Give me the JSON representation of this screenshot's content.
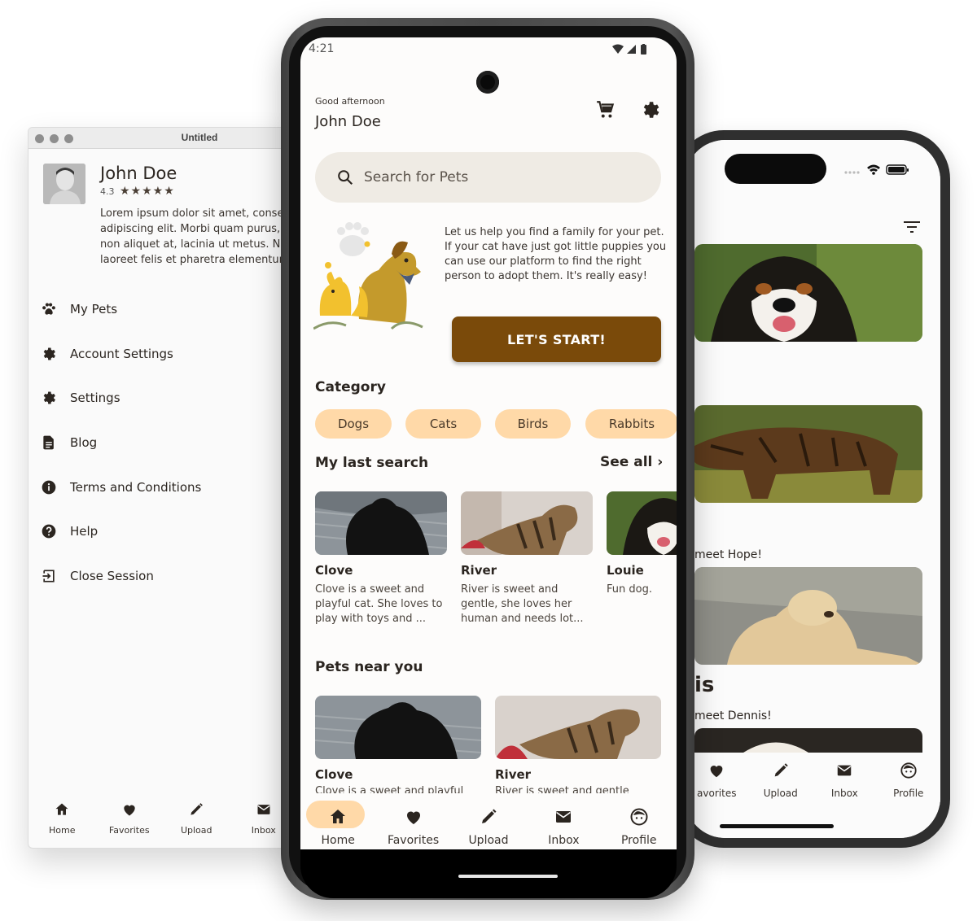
{
  "desktop": {
    "window_title": "Untitled",
    "profile": {
      "name": "John Doe",
      "rating": "4.3",
      "stars": "★★★★★",
      "bio_lines": [
        "Lorem ipsum dolor sit amet, conse",
        "adipiscing elit. Morbi quam purus,",
        "non aliquet at, lacinia ut metus. Nc",
        "laoreet felis et pharetra elementur"
      ]
    },
    "menu": [
      {
        "label": "My Pets",
        "icon": "paw-icon"
      },
      {
        "label": "Account Settings",
        "icon": "gear-icon"
      },
      {
        "label": "Settings",
        "icon": "gear-icon"
      },
      {
        "label": "Blog",
        "icon": "document-icon"
      },
      {
        "label": "Terms and Conditions",
        "icon": "info-icon"
      },
      {
        "label": "Help",
        "icon": "help-icon"
      },
      {
        "label": "Close Session",
        "icon": "logout-icon"
      }
    ],
    "nav": [
      {
        "label": "Home",
        "icon": "home-icon"
      },
      {
        "label": "Favorites",
        "icon": "heart-icon"
      },
      {
        "label": "Upload",
        "icon": "pencil-icon"
      },
      {
        "label": "Inbox",
        "icon": "mail-icon"
      }
    ]
  },
  "android": {
    "status": {
      "time": "4:21"
    },
    "greeting": "Good afternoon",
    "user_name": "John Doe",
    "search": {
      "placeholder": "Search for Pets"
    },
    "hero": {
      "text": "Let us help you find a family for your pet. If your cat have just got little puppies you can use our platform to find the right person to adopt them. It's really easy!",
      "button": "LET'S START!"
    },
    "category": {
      "title": "Category",
      "chips": [
        "Dogs",
        "Cats",
        "Birds",
        "Rabbits"
      ]
    },
    "last_search": {
      "title": "My last search",
      "see_all": "See all ›",
      "cards": [
        {
          "name": "Clove",
          "desc": "Clove is a sweet and playful cat. She loves to play with toys and ..."
        },
        {
          "name": "River",
          "desc": "River is sweet and gentle, she loves her human and needs lot..."
        },
        {
          "name": "Louie",
          "desc": "Fun dog."
        }
      ]
    },
    "near": {
      "title": "Pets near you",
      "cards": [
        {
          "name": "Clove",
          "desc": "Clove is a sweet and playful"
        },
        {
          "name": "River",
          "desc": "River is sweet and gentle"
        }
      ]
    },
    "nav": [
      {
        "label": "Home",
        "icon": "home-icon",
        "active": true
      },
      {
        "label": "Favorites",
        "icon": "heart-icon"
      },
      {
        "label": "Upload",
        "icon": "pencil-icon"
      },
      {
        "label": "Inbox",
        "icon": "mail-icon"
      },
      {
        "label": "Profile",
        "icon": "face-icon"
      }
    ]
  },
  "iphone": {
    "texts": {
      "meet_hope": "meet Hope!",
      "partial_name": "is",
      "meet_dennis": "meet Dennis!"
    },
    "nav": [
      {
        "label": "avorites",
        "icon": "heart-icon"
      },
      {
        "label": "Upload",
        "icon": "pencil-icon"
      },
      {
        "label": "Inbox",
        "icon": "mail-icon"
      },
      {
        "label": "Profile",
        "icon": "face-icon"
      }
    ]
  },
  "colors": {
    "accent_chip": "#ffd9a8",
    "button_brown": "#7a4a0a",
    "search_bg": "#efebe4",
    "text_dark": "#2b2520"
  }
}
